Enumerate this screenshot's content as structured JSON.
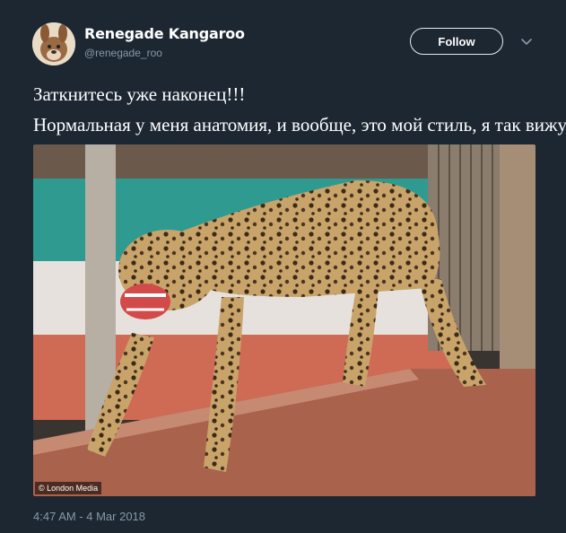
{
  "author": {
    "display_name": "Renegade Kangaroo",
    "handle": "@renegade_roo"
  },
  "follow_button": {
    "label": "Follow"
  },
  "tweet": {
    "lines": [
      "Заткнитесь уже наконец!!!",
      "Нормальная у меня анатомия, и вообще, это мой стиль, я так вижу"
    ],
    "image_credit": "© London Media"
  },
  "timestamp": "4:47 AM - 4 Mar 2018",
  "icons": {
    "avatar": "kangaroo-avatar-icon",
    "menu": "chevron-down-icon"
  },
  "colors": {
    "background": "#1c2732",
    "secondary_text": "#8899a6",
    "follow_border": "#e8ebee"
  }
}
